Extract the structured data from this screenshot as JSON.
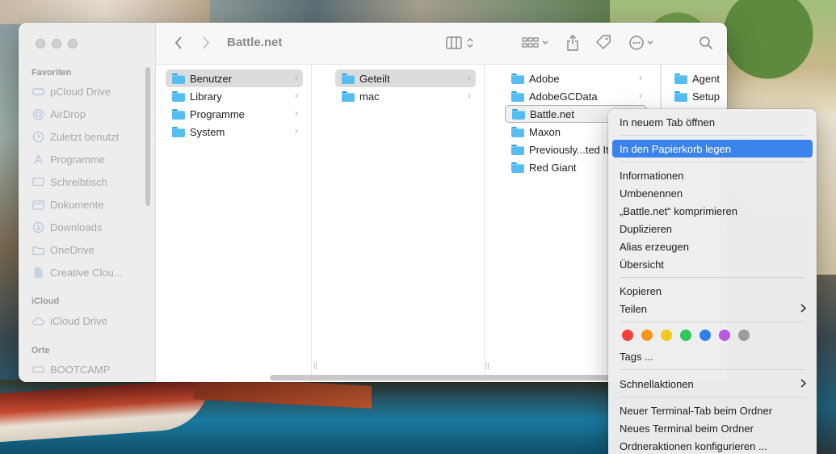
{
  "window": {
    "title": "Battle.net"
  },
  "sidebar": {
    "sections": [
      {
        "title": "Favoriten"
      },
      {
        "title": "iCloud"
      },
      {
        "title": "Orte"
      }
    ],
    "favorites": [
      {
        "label": "pCloud Drive",
        "icon": "cloud-drive-icon"
      },
      {
        "label": "AirDrop",
        "icon": "airdrop-icon"
      },
      {
        "label": "Zuletzt benutzt",
        "icon": "clock-icon"
      },
      {
        "label": "Programme",
        "icon": "applications-icon"
      },
      {
        "label": "Schreibtisch",
        "icon": "desktop-icon"
      },
      {
        "label": "Dokumente",
        "icon": "document-icon"
      },
      {
        "label": "Downloads",
        "icon": "download-icon"
      },
      {
        "label": "OneDrive",
        "icon": "folder-icon"
      },
      {
        "label": "Creative Clou...",
        "icon": "file-icon"
      }
    ],
    "icloud": [
      {
        "label": "iCloud Drive",
        "icon": "icloud-icon"
      }
    ],
    "places": [
      {
        "label": "BOOTCAMP",
        "icon": "disk-icon"
      }
    ]
  },
  "columns": [
    {
      "items": [
        {
          "label": "Benutzer",
          "has_children": true,
          "selected": true
        },
        {
          "label": "Library",
          "has_children": true
        },
        {
          "label": "Programme",
          "has_children": true
        },
        {
          "label": "System",
          "has_children": true
        }
      ]
    },
    {
      "items": [
        {
          "label": "Geteilt",
          "has_children": true,
          "selected": true
        },
        {
          "label": "mac",
          "has_children": true
        }
      ]
    },
    {
      "items": [
        {
          "label": "Adobe",
          "has_children": true
        },
        {
          "label": "AdobeGCData",
          "has_children": true
        },
        {
          "label": "Battle.net",
          "has_children": true,
          "selected": true
        },
        {
          "label": "Maxon",
          "has_children": false
        },
        {
          "label": "Previously...ted Items",
          "has_children": false
        },
        {
          "label": "Red Giant",
          "has_children": false
        }
      ]
    },
    {
      "items": [
        {
          "label": "Agent"
        },
        {
          "label": "Setup"
        }
      ]
    }
  ],
  "context_menu": {
    "items": [
      {
        "label": "In neuem Tab öffnen"
      },
      {
        "label": "In den Papierkorb legen",
        "highlighted": true
      },
      {
        "label": "Informationen"
      },
      {
        "label": "Umbenennen"
      },
      {
        "label": "„Battle.net“ komprimieren"
      },
      {
        "label": "Duplizieren"
      },
      {
        "label": "Alias erzeugen"
      },
      {
        "label": "Übersicht"
      },
      {
        "label": "Kopieren"
      },
      {
        "label": "Teilen",
        "submenu": true
      },
      {
        "label": "Tags ..."
      },
      {
        "label": "Schnellaktionen",
        "submenu": true
      },
      {
        "label": "Neuer Terminal-Tab beim Ordner"
      },
      {
        "label": "Neues Terminal beim Ordner"
      },
      {
        "label": "Ordneraktionen konfigurieren ..."
      }
    ],
    "tag_colors": [
      "#f2403a",
      "#f7961c",
      "#f5c81a",
      "#30c85a",
      "#2f80ed",
      "#b85ae0",
      "#9b9b9b"
    ]
  }
}
